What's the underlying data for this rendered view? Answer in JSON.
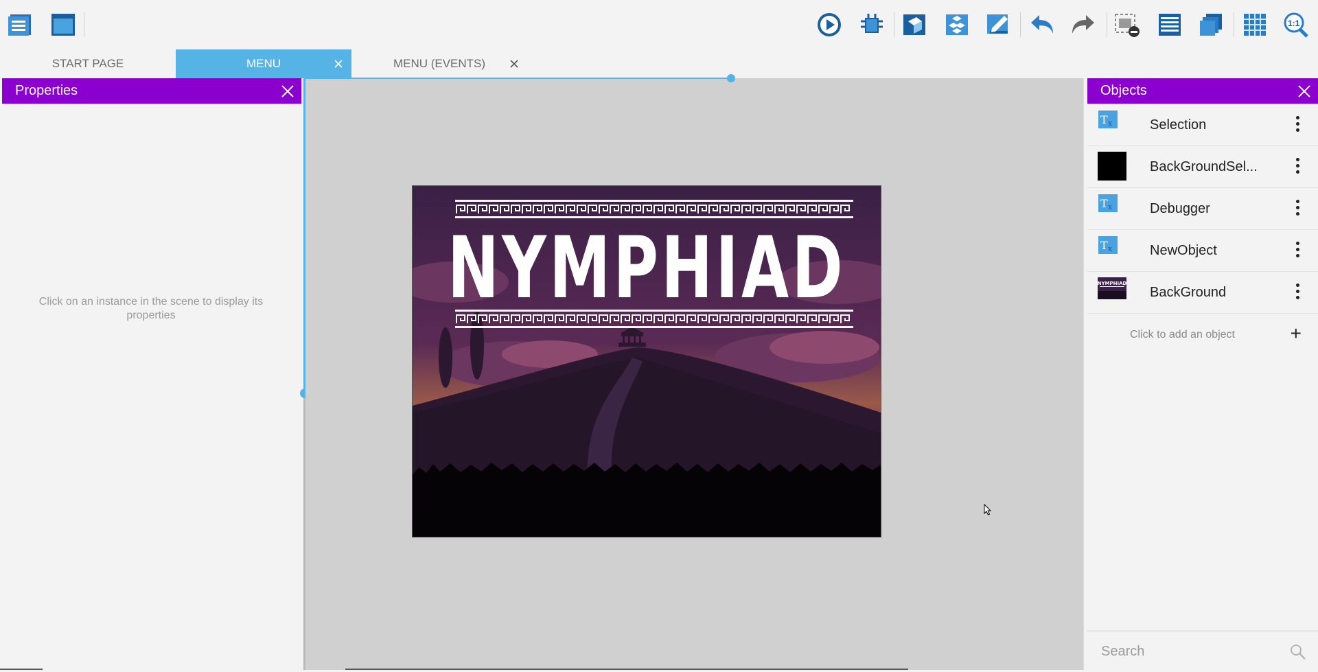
{
  "tabs": [
    {
      "label": "START PAGE",
      "active": false
    },
    {
      "label": "MENU",
      "active": true
    },
    {
      "label": "MENU (EVENTS)",
      "active": false
    }
  ],
  "properties": {
    "title": "Properties",
    "empty_message": "Click on an instance in the scene to display its properties"
  },
  "objects": {
    "title": "Objects",
    "items": [
      {
        "name": "Selection",
        "icon": "text-object-icon"
      },
      {
        "name": "BackGroundSel...",
        "icon": "black-sprite-icon"
      },
      {
        "name": "Debugger",
        "icon": "text-object-icon"
      },
      {
        "name": "NewObject",
        "icon": "text-object-icon"
      },
      {
        "name": "BackGround",
        "icon": "nymphiad-sprite-icon"
      }
    ],
    "add_label": "Click to add an object",
    "search_placeholder": "Search"
  },
  "scene": {
    "game_title": "NYMPHIAD",
    "thumb_title": "NYMPHIAD"
  },
  "colors": {
    "accent": "#55b4e5",
    "panel_header": "#8a00cc",
    "scene_bg": "#d0d0d0"
  }
}
